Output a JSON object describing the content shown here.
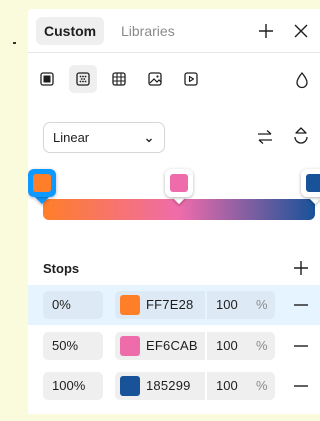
{
  "header": {
    "tabs": [
      {
        "label": "Custom",
        "active": true
      },
      {
        "label": "Libraries",
        "active": false
      }
    ],
    "add_icon": "plus-icon",
    "close_icon": "close-icon"
  },
  "fill_types": [
    {
      "name": "solid",
      "icon": "solid-fill-icon",
      "active": false
    },
    {
      "name": "gradient",
      "icon": "gradient-fill-icon",
      "active": true
    },
    {
      "name": "pattern",
      "icon": "pattern-fill-icon",
      "active": false
    },
    {
      "name": "image",
      "icon": "image-fill-icon",
      "active": false
    },
    {
      "name": "video",
      "icon": "video-fill-icon",
      "active": false
    }
  ],
  "opacity_icon": "droplet-icon",
  "gradient": {
    "type_selected": "Linear",
    "flip_icon": "swap-arrows-icon",
    "rotate_icon": "rotate-icon"
  },
  "stops_section": {
    "title": "Stops",
    "add_icon": "plus-icon"
  },
  "stops": [
    {
      "position": "0%",
      "hex": "FF7E28",
      "color": "#FF7E28",
      "opacity": "100",
      "unit": "%",
      "selected": true,
      "position_fraction": 0
    },
    {
      "position": "50%",
      "hex": "EF6CAB",
      "color": "#EF6CAB",
      "opacity": "100",
      "unit": "%",
      "selected": false,
      "position_fraction": 0.5
    },
    {
      "position": "100%",
      "hex": "185299",
      "color": "#185299",
      "opacity": "100",
      "unit": "%",
      "selected": false,
      "position_fraction": 1
    }
  ],
  "colors": {
    "accent": "#0d99ff",
    "selected_row": "#e5f4ff"
  }
}
